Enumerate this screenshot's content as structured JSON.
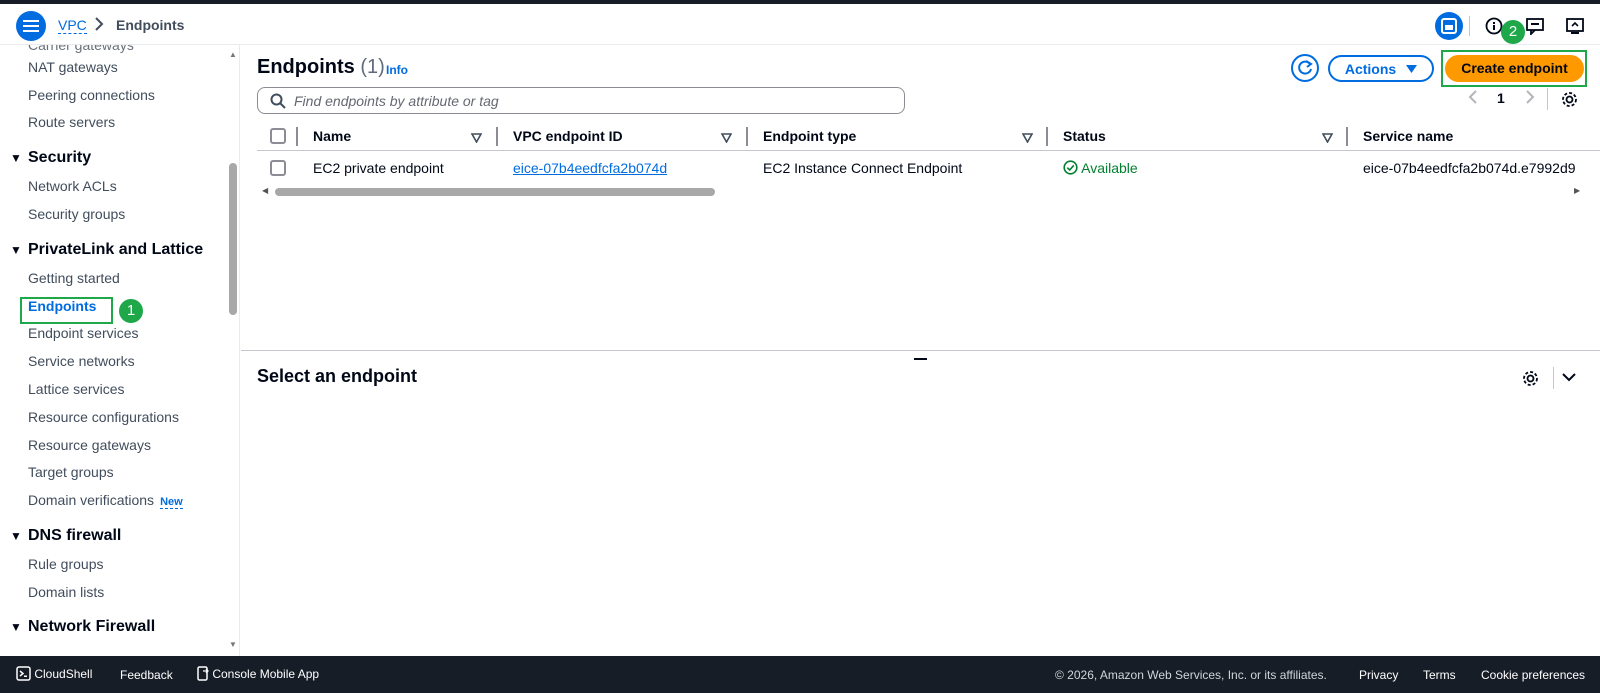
{
  "breadcrumb": {
    "service": "VPC",
    "current": "Endpoints"
  },
  "badges": {
    "one": "1",
    "two": "2"
  },
  "sidebar": {
    "top_items": [
      "NAT gateways",
      "Peering connections",
      "Route servers"
    ],
    "sections": [
      {
        "title": "Security",
        "items": [
          "Network ACLs",
          "Security groups"
        ]
      },
      {
        "title": "PrivateLink and Lattice",
        "items": [
          "Getting started",
          "Endpoints",
          "Endpoint services",
          "Service networks",
          "Lattice services",
          "Resource configurations",
          "Resource gateways",
          "Target groups",
          "Domain verifications"
        ]
      },
      {
        "title": "DNS firewall",
        "items": [
          "Rule groups",
          "Domain lists"
        ]
      },
      {
        "title": "Network Firewall",
        "items": []
      }
    ],
    "new_badge": "New",
    "active_item": "Endpoints"
  },
  "main": {
    "title": "Endpoints",
    "count": "(1)",
    "info": "Info",
    "search_placeholder": "Find endpoints by attribute or tag",
    "actions_label": "Actions",
    "create_label": "Create endpoint",
    "page_number": "1",
    "columns": [
      "Name",
      "VPC endpoint ID",
      "Endpoint type",
      "Status",
      "Service name"
    ],
    "rows": [
      {
        "name": "EC2 private endpoint",
        "id": "eice-07b4eedfcfa2b074d",
        "type": "EC2 Instance Connect Endpoint",
        "status": "Available",
        "service": "eice-07b4eedfcfa2b074d.e7992d9"
      }
    ]
  },
  "detail": {
    "title": "Select an endpoint"
  },
  "footer": {
    "cloudshell": "CloudShell",
    "feedback": "Feedback",
    "mobile": "Console Mobile App",
    "copyright": "© 2026, Amazon Web Services, Inc. or its affiliates.",
    "privacy": "Privacy",
    "terms": "Terms",
    "cookies": "Cookie preferences"
  },
  "colors": {
    "accent": "#006ce0",
    "primary_button": "#ff9900",
    "highlight": "#1ea84a",
    "available": "#00802f",
    "footer": "#161d26"
  }
}
